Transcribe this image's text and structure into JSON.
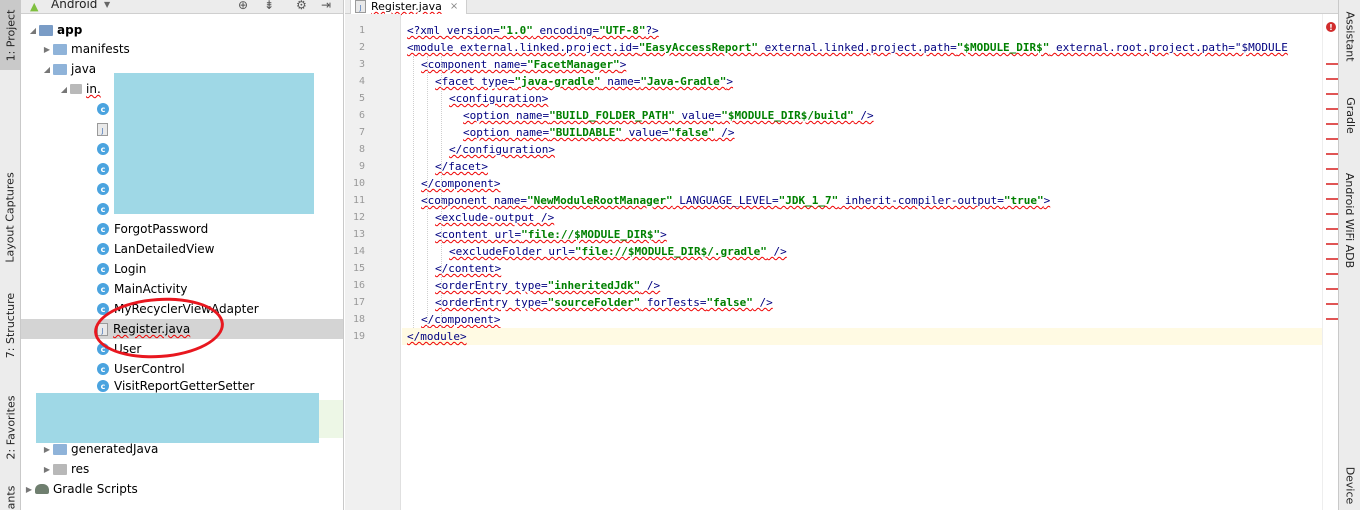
{
  "left_toolbar": {
    "project": "1: Project",
    "captures": "Layout Captures",
    "structure": "7: Structure",
    "favorites": "2: Favorites",
    "variants": "ants"
  },
  "project_panel": {
    "view": "Android",
    "tree": {
      "app": "app",
      "manifests": "manifests",
      "java": "java",
      "package": "in.",
      "files": [
        "ForgotPassword",
        "LanDetailedView",
        "Login",
        "MainActivity",
        "MyRecyclerViewAdapter",
        "Register.java",
        "User",
        "UserControl",
        "VisitReportGetterSetter"
      ],
      "generatedJava": "generatedJava",
      "res": "res",
      "gradle": "Gradle Scripts"
    }
  },
  "editor": {
    "tab": "Register.java",
    "lines": [
      {
        "n": "1",
        "indent": 0,
        "text": "<?xml version=\"1.0\" encoding=\"UTF-8\"?>"
      },
      {
        "n": "2",
        "indent": 0,
        "text": "<module external.linked.project.id=\"EasyAccessReport\" external.linked.project.path=\"$MODULE_DIR$\" external.root.project.path=\"$MODULE"
      },
      {
        "n": "3",
        "indent": 1,
        "text": "<component name=\"FacetManager\">"
      },
      {
        "n": "4",
        "indent": 2,
        "text": "<facet type=\"java-gradle\" name=\"Java-Gradle\">"
      },
      {
        "n": "5",
        "indent": 3,
        "text": "<configuration>"
      },
      {
        "n": "6",
        "indent": 4,
        "text": "<option name=\"BUILD_FOLDER_PATH\" value=\"$MODULE_DIR$/build\" />"
      },
      {
        "n": "7",
        "indent": 4,
        "text": "<option name=\"BUILDABLE\" value=\"false\" />"
      },
      {
        "n": "8",
        "indent": 3,
        "text": "</configuration>"
      },
      {
        "n": "9",
        "indent": 2,
        "text": "</facet>"
      },
      {
        "n": "10",
        "indent": 1,
        "text": "</component>"
      },
      {
        "n": "11",
        "indent": 1,
        "text": "<component name=\"NewModuleRootManager\" LANGUAGE_LEVEL=\"JDK_1_7\" inherit-compiler-output=\"true\">"
      },
      {
        "n": "12",
        "indent": 2,
        "text": "<exclude-output />"
      },
      {
        "n": "13",
        "indent": 2,
        "text": "<content url=\"file://$MODULE_DIR$\">"
      },
      {
        "n": "14",
        "indent": 3,
        "text": "<excludeFolder url=\"file://$MODULE_DIR$/.gradle\" />"
      },
      {
        "n": "15",
        "indent": 2,
        "text": "</content>"
      },
      {
        "n": "16",
        "indent": 2,
        "text": "<orderEntry type=\"inheritedJdk\" />"
      },
      {
        "n": "17",
        "indent": 2,
        "text": "<orderEntry type=\"sourceFolder\" forTests=\"false\" />"
      },
      {
        "n": "18",
        "indent": 1,
        "text": "</component>"
      },
      {
        "n": "19",
        "indent": 0,
        "text": "</module>"
      }
    ]
  },
  "right_toolbar": {
    "assistant": "Assistant",
    "gradle": "Gradle",
    "adb": "Android WiFi ADB",
    "device": "Device"
  },
  "colors": {
    "redaction": "#9fd8e6",
    "annotation": "#e8171f",
    "tag": "#000080",
    "value": "#008000"
  }
}
